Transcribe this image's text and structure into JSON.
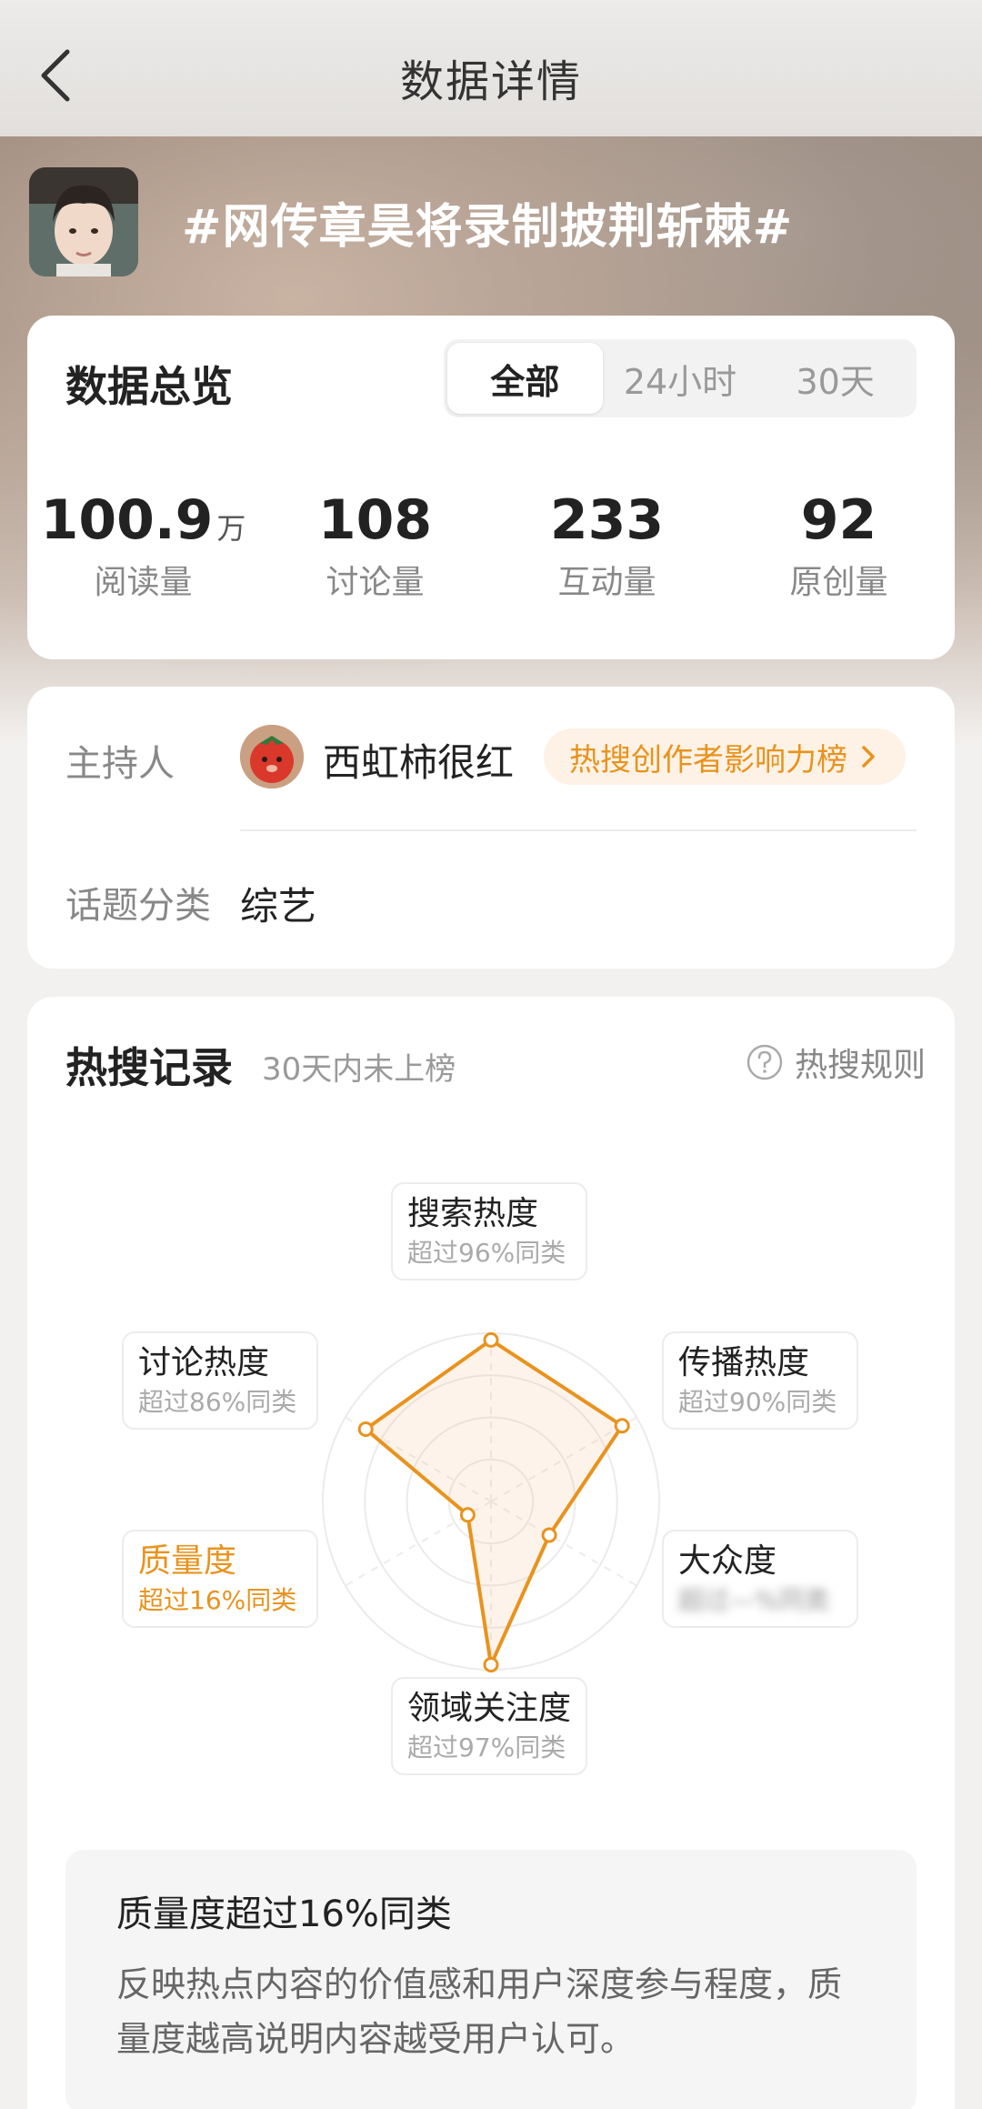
{
  "nav": {
    "title": "数据详情",
    "back_icon": "chevron-left-icon"
  },
  "topic": {
    "title": "#网传章昊将录制披荆斩棘#"
  },
  "overview": {
    "title": "数据总览",
    "tabs": [
      {
        "label": "全部",
        "active": true
      },
      {
        "label": "24小时",
        "active": false
      },
      {
        "label": "30天",
        "active": false
      }
    ],
    "stats": [
      {
        "value": "100.9",
        "unit": "万",
        "label": "阅读量"
      },
      {
        "value": "108",
        "unit": "",
        "label": "讨论量"
      },
      {
        "value": "233",
        "unit": "",
        "label": "互动量"
      },
      {
        "value": "92",
        "unit": "",
        "label": "原创量"
      }
    ]
  },
  "host": {
    "label": "主持人",
    "name": "西虹柿很红",
    "badge": "热搜创作者影响力榜",
    "category_label": "话题分类",
    "category_value": "综艺"
  },
  "hot": {
    "title": "热搜记录",
    "subtitle": "30天内未上榜",
    "rules_label": "热搜规则",
    "metrics": [
      {
        "name": "搜索热度",
        "pct": "超过96%同类",
        "level": 0.96
      },
      {
        "name": "传播热度",
        "pct": "超过90%同类",
        "level": 0.9
      },
      {
        "name": "大众度",
        "pct": "超过—%同类",
        "level": 0.4
      },
      {
        "name": "领域关注度",
        "pct": "超过97%同类",
        "level": 0.97
      },
      {
        "name": "质量度",
        "pct": "超过16%同类",
        "level": 0.16
      },
      {
        "name": "讨论热度",
        "pct": "超过86%同类",
        "level": 0.86
      }
    ],
    "desc_title": "质量度超过16%同类",
    "desc_text": "反映热点内容的价值感和用户深度参与程度，质量度越高说明内容越受用户认可。"
  },
  "colors": {
    "accent": "#e8931e",
    "badge_bg": "#fdf2e5"
  }
}
